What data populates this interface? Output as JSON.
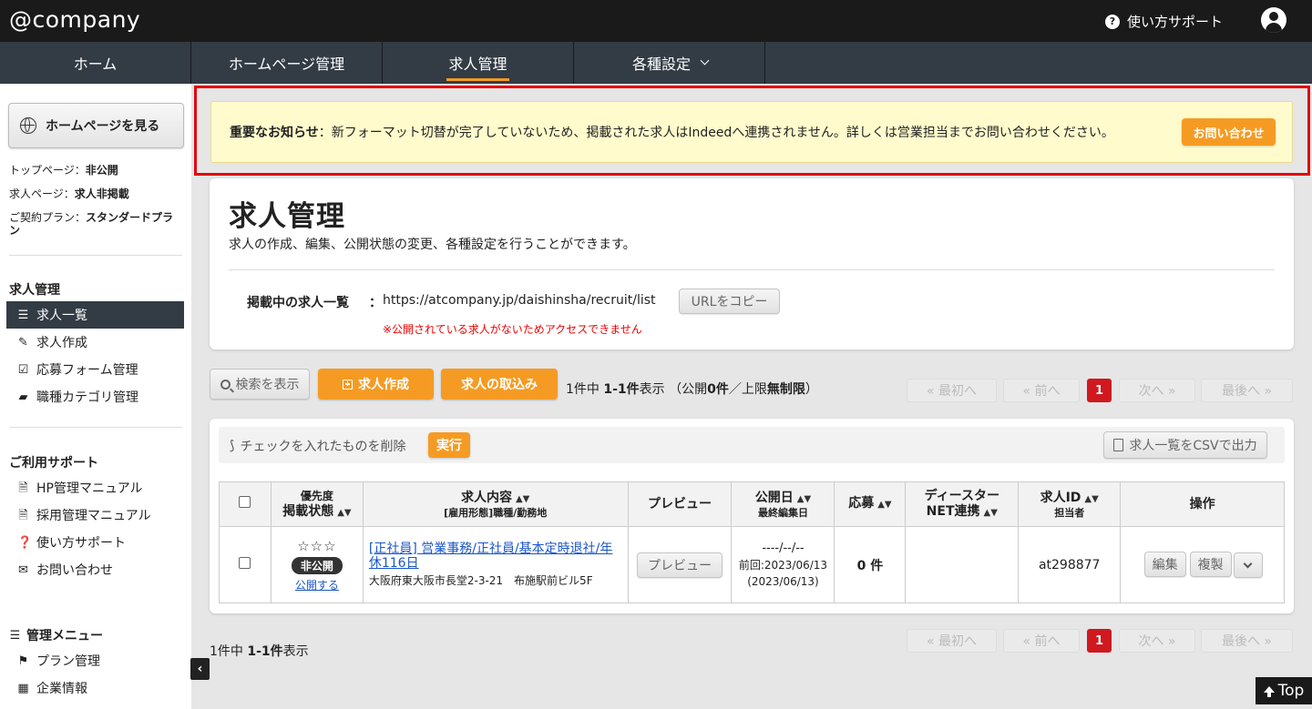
{
  "header": {
    "logo": "@company",
    "help_label": "使い方サポート"
  },
  "nav": {
    "tabs": [
      {
        "label": "ホーム"
      },
      {
        "label": "ホームページ管理"
      },
      {
        "label": "求人管理",
        "active": true
      },
      {
        "label": "各種設定"
      }
    ]
  },
  "sidebar": {
    "view_homepage": "ホームページを見る",
    "info": [
      {
        "label": "トップページ：",
        "value": "非公開"
      },
      {
        "label": "求人ページ：",
        "value": "求人非掲載"
      },
      {
        "label": "ご契約プラン：",
        "value": "スタンダードプラン"
      }
    ],
    "section_jobs": "求人管理",
    "jobs_items": [
      {
        "label": "求人一覧",
        "icon": "list-icon",
        "active": true
      },
      {
        "label": "求人作成",
        "icon": "edit-icon"
      },
      {
        "label": "応募フォーム管理",
        "icon": "checkbox-icon"
      },
      {
        "label": "職種カテゴリ管理",
        "icon": "briefcase-icon"
      }
    ],
    "section_support": "ご利用サポート",
    "support_items": [
      {
        "label": "HP管理マニュアル",
        "icon": "pdf-icon"
      },
      {
        "label": "採用管理マニュアル",
        "icon": "pdf-icon"
      },
      {
        "label": "使い方サポート",
        "icon": "question-icon"
      },
      {
        "label": "お問い合わせ",
        "icon": "mail-icon"
      }
    ],
    "section_admin": "管理メニュー",
    "admin_items": [
      {
        "label": "プラン管理",
        "icon": "flag-icon"
      },
      {
        "label": "企業情報",
        "icon": "building-icon"
      }
    ]
  },
  "notice": {
    "title": "重要なお知らせ",
    "text": "：新フォーマット切替が完了していないため、掲載された求人はIndeedへ連携されません。詳しくは営業担当までお問い合わせください。",
    "contact_button": "お問い合わせ"
  },
  "page": {
    "title": "求人管理",
    "subtitle": "求人の作成、編集、公開状態の変更、各種設定を行うことができます。",
    "url_label": "掲載中の求人一覧",
    "url_colon": "：",
    "url_value": "https://atcompany.jp/daishinsha/recruit/list",
    "copy_button": "URLをコピー",
    "warning": "※公開されている求人がないためアクセスできません"
  },
  "toolbar": {
    "search_button": "検索を表示",
    "create_button": "求人作成",
    "import_button": "求人の取込み",
    "count_prefix": "1件中 ",
    "count_range": "1-1件",
    "count_suffix": "表示 （公開",
    "count_public": "0件",
    "count_sep": "／上限",
    "count_limit": "無制限",
    "count_close": "）"
  },
  "pagination": {
    "first": "« 最初へ",
    "prev": "« 前へ",
    "current": "1",
    "next": "次へ »",
    "last": "最後へ »"
  },
  "bulk": {
    "label": "チェックを入れたものを削除",
    "run_button": "実行",
    "csv_button": "求人一覧をCSVで出力"
  },
  "table": {
    "headers": {
      "priority": "優先度",
      "status": "掲載状態",
      "content": "求人内容",
      "content_sub": "[雇用形態]職種/勤務地",
      "preview": "プレビュー",
      "publish_date": "公開日",
      "last_edit": "最終編集日",
      "applications": "応募",
      "dister": "ディースター",
      "net": "NET連携",
      "job_id": "求人ID",
      "owner": "担当者",
      "actions": "操作"
    },
    "rows": [
      {
        "stars": "☆☆☆",
        "status": "非公開",
        "publish_link": "公開する",
        "title": "[正社員] 営業事務/正社員/基本定時退社/年休116日",
        "address": "大阪府東大阪市長堂2-3-21　布施駅前ビル5F",
        "preview_button": "プレビュー",
        "publish_date": "----/--/--",
        "prev_date": "前回:2023/06/13",
        "last_edit": "(2023/06/13)",
        "applications": "0 件",
        "dister": "",
        "job_id": "at298877",
        "edit_button": "編集",
        "copy_button": "複製"
      }
    ]
  },
  "footer": {
    "count_prefix": "1件中 ",
    "count_range": "1-1件",
    "count_suffix": "表示",
    "top_button": "Top"
  }
}
